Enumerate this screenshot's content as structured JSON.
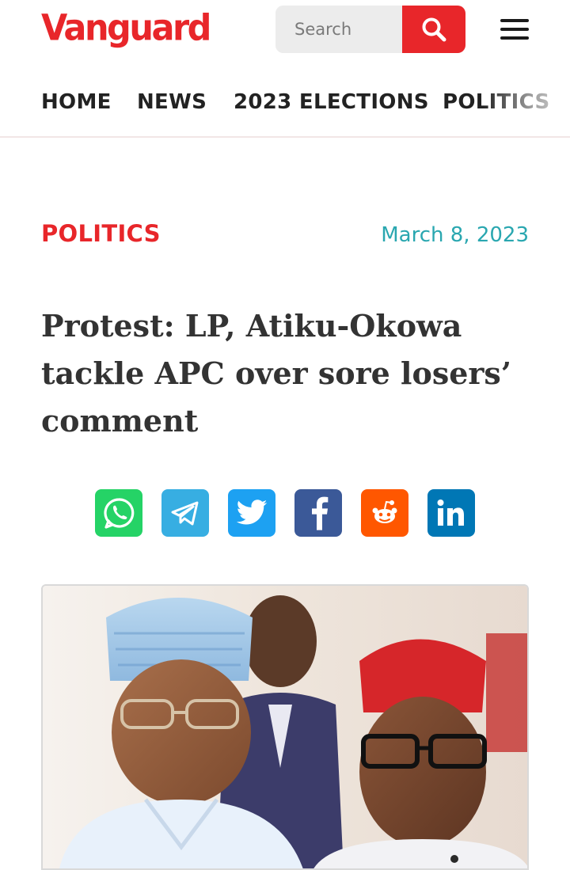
{
  "header": {
    "logo": "Vanguard",
    "search_placeholder": "Search",
    "brand_color": "#e8262a"
  },
  "nav": {
    "items": [
      "HOME",
      "NEWS",
      "2023 ELECTIONS",
      "POLITICS"
    ]
  },
  "article": {
    "category": "POLITICS",
    "date": "March 8, 2023",
    "headline": "Protest: LP, Atiku-Okowa tackle APC over sore losers’ comment"
  },
  "share": {
    "buttons": [
      {
        "name": "whatsapp",
        "icon": "whatsapp-icon",
        "color": "#25d366"
      },
      {
        "name": "telegram",
        "icon": "telegram-icon",
        "color": "#37aee2"
      },
      {
        "name": "twitter",
        "icon": "twitter-icon",
        "color": "#1da1f2"
      },
      {
        "name": "facebook",
        "icon": "facebook-icon",
        "color": "#3b5998"
      },
      {
        "name": "reddit",
        "icon": "reddit-icon",
        "color": "#ff5700"
      },
      {
        "name": "linkedin",
        "icon": "linkedin-icon",
        "color": "#0077b5"
      }
    ]
  }
}
